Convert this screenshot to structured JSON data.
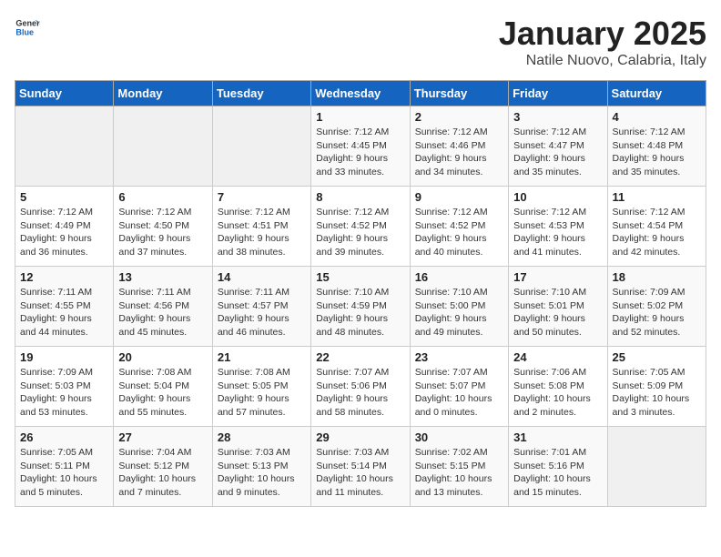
{
  "header": {
    "logo_general": "General",
    "logo_blue": "Blue",
    "month_title": "January 2025",
    "subtitle": "Natile Nuovo, Calabria, Italy"
  },
  "days_of_week": [
    "Sunday",
    "Monday",
    "Tuesday",
    "Wednesday",
    "Thursday",
    "Friday",
    "Saturday"
  ],
  "weeks": [
    [
      {
        "day": "",
        "info": ""
      },
      {
        "day": "",
        "info": ""
      },
      {
        "day": "",
        "info": ""
      },
      {
        "day": "1",
        "info": "Sunrise: 7:12 AM\nSunset: 4:45 PM\nDaylight: 9 hours\nand 33 minutes."
      },
      {
        "day": "2",
        "info": "Sunrise: 7:12 AM\nSunset: 4:46 PM\nDaylight: 9 hours\nand 34 minutes."
      },
      {
        "day": "3",
        "info": "Sunrise: 7:12 AM\nSunset: 4:47 PM\nDaylight: 9 hours\nand 35 minutes."
      },
      {
        "day": "4",
        "info": "Sunrise: 7:12 AM\nSunset: 4:48 PM\nDaylight: 9 hours\nand 35 minutes."
      }
    ],
    [
      {
        "day": "5",
        "info": "Sunrise: 7:12 AM\nSunset: 4:49 PM\nDaylight: 9 hours\nand 36 minutes."
      },
      {
        "day": "6",
        "info": "Sunrise: 7:12 AM\nSunset: 4:50 PM\nDaylight: 9 hours\nand 37 minutes."
      },
      {
        "day": "7",
        "info": "Sunrise: 7:12 AM\nSunset: 4:51 PM\nDaylight: 9 hours\nand 38 minutes."
      },
      {
        "day": "8",
        "info": "Sunrise: 7:12 AM\nSunset: 4:52 PM\nDaylight: 9 hours\nand 39 minutes."
      },
      {
        "day": "9",
        "info": "Sunrise: 7:12 AM\nSunset: 4:52 PM\nDaylight: 9 hours\nand 40 minutes."
      },
      {
        "day": "10",
        "info": "Sunrise: 7:12 AM\nSunset: 4:53 PM\nDaylight: 9 hours\nand 41 minutes."
      },
      {
        "day": "11",
        "info": "Sunrise: 7:12 AM\nSunset: 4:54 PM\nDaylight: 9 hours\nand 42 minutes."
      }
    ],
    [
      {
        "day": "12",
        "info": "Sunrise: 7:11 AM\nSunset: 4:55 PM\nDaylight: 9 hours\nand 44 minutes."
      },
      {
        "day": "13",
        "info": "Sunrise: 7:11 AM\nSunset: 4:56 PM\nDaylight: 9 hours\nand 45 minutes."
      },
      {
        "day": "14",
        "info": "Sunrise: 7:11 AM\nSunset: 4:57 PM\nDaylight: 9 hours\nand 46 minutes."
      },
      {
        "day": "15",
        "info": "Sunrise: 7:10 AM\nSunset: 4:59 PM\nDaylight: 9 hours\nand 48 minutes."
      },
      {
        "day": "16",
        "info": "Sunrise: 7:10 AM\nSunset: 5:00 PM\nDaylight: 9 hours\nand 49 minutes."
      },
      {
        "day": "17",
        "info": "Sunrise: 7:10 AM\nSunset: 5:01 PM\nDaylight: 9 hours\nand 50 minutes."
      },
      {
        "day": "18",
        "info": "Sunrise: 7:09 AM\nSunset: 5:02 PM\nDaylight: 9 hours\nand 52 minutes."
      }
    ],
    [
      {
        "day": "19",
        "info": "Sunrise: 7:09 AM\nSunset: 5:03 PM\nDaylight: 9 hours\nand 53 minutes."
      },
      {
        "day": "20",
        "info": "Sunrise: 7:08 AM\nSunset: 5:04 PM\nDaylight: 9 hours\nand 55 minutes."
      },
      {
        "day": "21",
        "info": "Sunrise: 7:08 AM\nSunset: 5:05 PM\nDaylight: 9 hours\nand 57 minutes."
      },
      {
        "day": "22",
        "info": "Sunrise: 7:07 AM\nSunset: 5:06 PM\nDaylight: 9 hours\nand 58 minutes."
      },
      {
        "day": "23",
        "info": "Sunrise: 7:07 AM\nSunset: 5:07 PM\nDaylight: 10 hours\nand 0 minutes."
      },
      {
        "day": "24",
        "info": "Sunrise: 7:06 AM\nSunset: 5:08 PM\nDaylight: 10 hours\nand 2 minutes."
      },
      {
        "day": "25",
        "info": "Sunrise: 7:05 AM\nSunset: 5:09 PM\nDaylight: 10 hours\nand 3 minutes."
      }
    ],
    [
      {
        "day": "26",
        "info": "Sunrise: 7:05 AM\nSunset: 5:11 PM\nDaylight: 10 hours\nand 5 minutes."
      },
      {
        "day": "27",
        "info": "Sunrise: 7:04 AM\nSunset: 5:12 PM\nDaylight: 10 hours\nand 7 minutes."
      },
      {
        "day": "28",
        "info": "Sunrise: 7:03 AM\nSunset: 5:13 PM\nDaylight: 10 hours\nand 9 minutes."
      },
      {
        "day": "29",
        "info": "Sunrise: 7:03 AM\nSunset: 5:14 PM\nDaylight: 10 hours\nand 11 minutes."
      },
      {
        "day": "30",
        "info": "Sunrise: 7:02 AM\nSunset: 5:15 PM\nDaylight: 10 hours\nand 13 minutes."
      },
      {
        "day": "31",
        "info": "Sunrise: 7:01 AM\nSunset: 5:16 PM\nDaylight: 10 hours\nand 15 minutes."
      },
      {
        "day": "",
        "info": ""
      }
    ]
  ]
}
